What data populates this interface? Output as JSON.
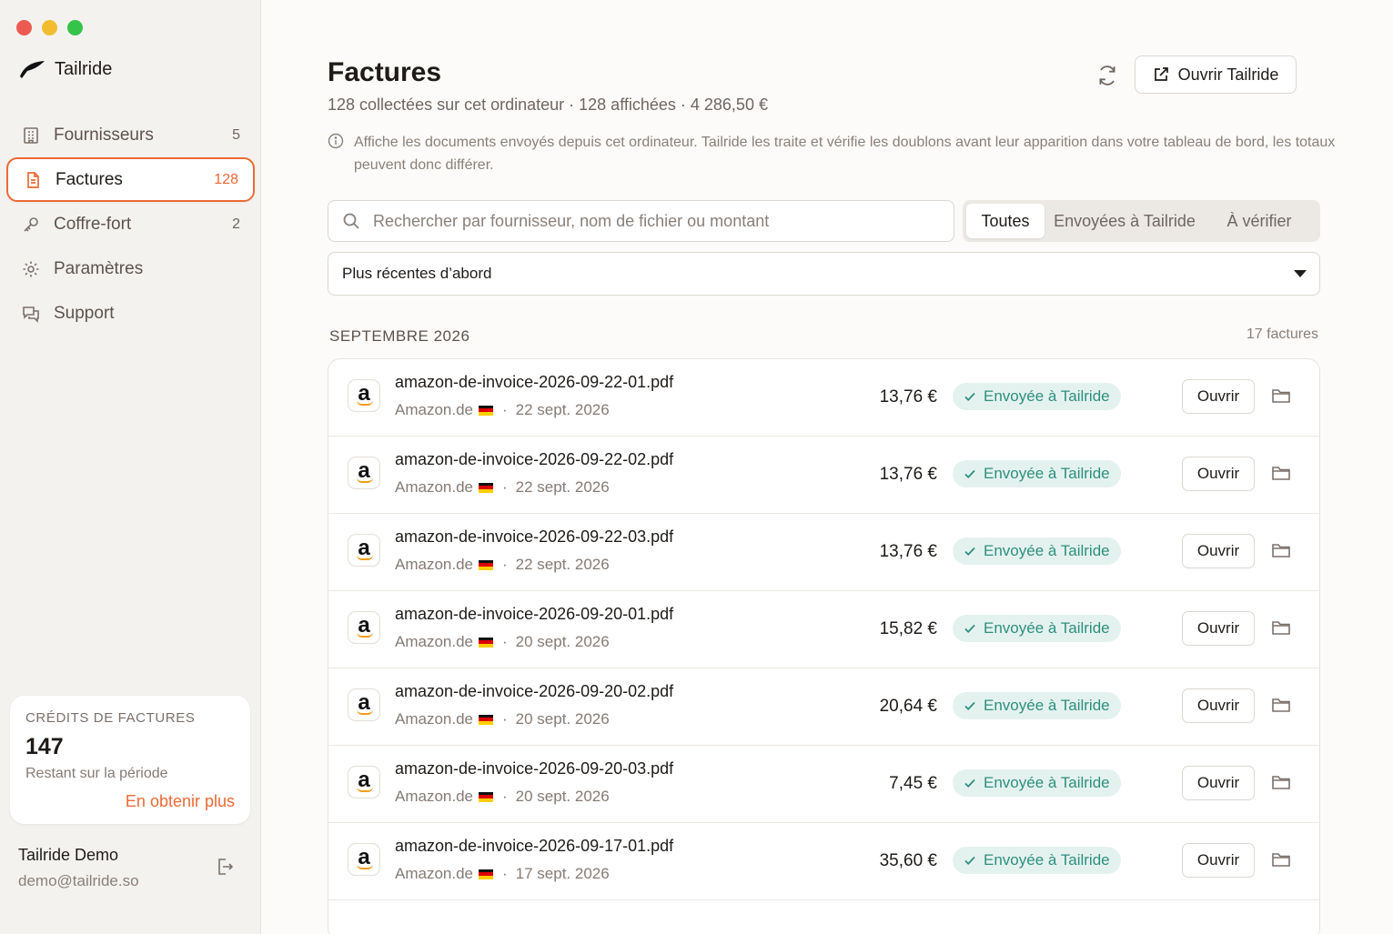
{
  "window": {
    "traffic_lights": [
      "close",
      "minimize",
      "zoom"
    ]
  },
  "brand": {
    "name": "Tailride",
    "icon": "tailride-logo-icon"
  },
  "sidebar": {
    "items": [
      {
        "label": "Fournisseurs",
        "count": "5",
        "icon": "building-icon",
        "active": false
      },
      {
        "label": "Factures",
        "count": "128",
        "icon": "document-icon",
        "active": true
      },
      {
        "label": "Coffre-fort",
        "count": "2",
        "icon": "key-icon",
        "active": false
      },
      {
        "label": "Paramètres",
        "count": "",
        "icon": "gear-icon",
        "active": false
      },
      {
        "label": "Support",
        "count": "",
        "icon": "chat-icon",
        "active": false
      }
    ],
    "accent_color": "#ec6a34"
  },
  "credits": {
    "title": "CRÉDITS DE FACTURES",
    "value": "147",
    "subtitle": "Restant sur la période",
    "cta": "En obtenir plus"
  },
  "user": {
    "name": "Tailride Demo",
    "email": "demo@tailride.so"
  },
  "header": {
    "title": "Factures",
    "subtitle": "128 collectées sur cet ordinateur · 128 affichées · 4 286,50 €",
    "open_button": "Ouvrir Tailride",
    "info": "Affiche les documents envoyés depuis cet ordinateur. Tailride les traite et vérifie les doublons avant leur apparition dans votre tableau de bord, les totaux peuvent donc différer."
  },
  "search": {
    "placeholder": "Rechercher par fournisseur, nom de fichier ou montant",
    "value": ""
  },
  "filters": {
    "options": [
      "Toutes",
      "Envoyées à Tailride",
      "À vérifier"
    ],
    "selected": "Toutes"
  },
  "sort": {
    "selected": "Plus récentes d’abord"
  },
  "group": {
    "month": "SEPTEMBRE 2026",
    "count": "17 factures"
  },
  "invoices": [
    {
      "file": "amazon-de-invoice-2026-09-22-01.pdf",
      "vendor": "Amazon.de",
      "date": "22 sept. 2026",
      "amount": "13,76 €",
      "status": "Envoyée à Tailride",
      "action": "Ouvrir"
    },
    {
      "file": "amazon-de-invoice-2026-09-22-02.pdf",
      "vendor": "Amazon.de",
      "date": "22 sept. 2026",
      "amount": "13,76 €",
      "status": "Envoyée à Tailride",
      "action": "Ouvrir"
    },
    {
      "file": "amazon-de-invoice-2026-09-22-03.pdf",
      "vendor": "Amazon.de",
      "date": "22 sept. 2026",
      "amount": "13,76 €",
      "status": "Envoyée à Tailride",
      "action": "Ouvrir"
    },
    {
      "file": "amazon-de-invoice-2026-09-20-01.pdf",
      "vendor": "Amazon.de",
      "date": "20 sept. 2026",
      "amount": "15,82 €",
      "status": "Envoyée à Tailride",
      "action": "Ouvrir"
    },
    {
      "file": "amazon-de-invoice-2026-09-20-02.pdf",
      "vendor": "Amazon.de",
      "date": "20 sept. 2026",
      "amount": "20,64 €",
      "status": "Envoyée à Tailride",
      "action": "Ouvrir"
    },
    {
      "file": "amazon-de-invoice-2026-09-20-03.pdf",
      "vendor": "Amazon.de",
      "date": "20 sept. 2026",
      "amount": "7,45 €",
      "status": "Envoyée à Tailride",
      "action": "Ouvrir"
    },
    {
      "file": "amazon-de-invoice-2026-09-17-01.pdf",
      "vendor": "Amazon.de",
      "date": "17 sept. 2026",
      "amount": "35,60 €",
      "status": "Envoyée à Tailride",
      "action": "Ouvrir"
    }
  ]
}
